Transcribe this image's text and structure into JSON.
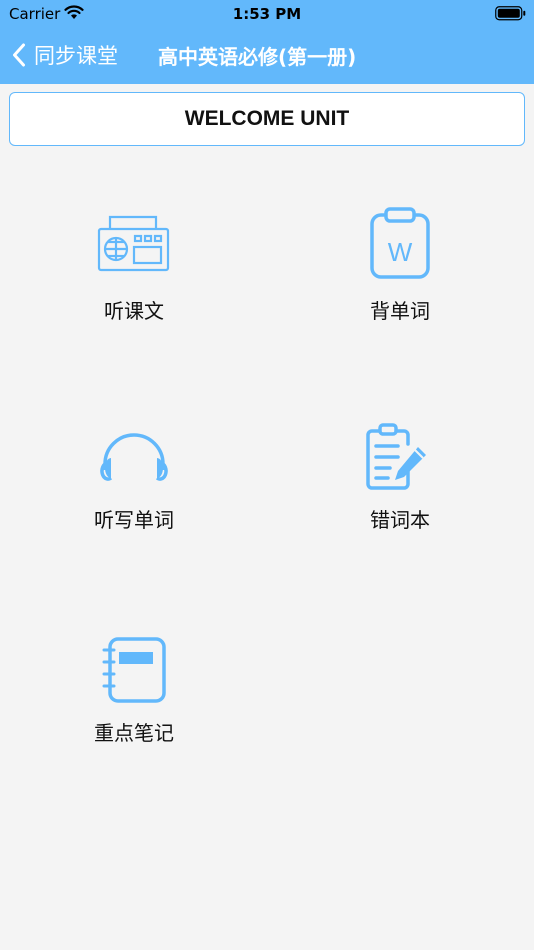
{
  "status_bar": {
    "carrier": "Carrier",
    "time": "1:53 PM"
  },
  "nav": {
    "back_label": "同步课堂",
    "title": "高中英语必修(第一册)"
  },
  "unit_button": {
    "label": "WELCOME UNIT"
  },
  "menu": {
    "listen_text": "听课文",
    "recite_words": "背单词",
    "dictation": "听写单词",
    "wrong_words": "错词本",
    "key_notes": "重点笔记"
  },
  "colors": {
    "accent": "#62b8fb",
    "background": "#f4f4f4"
  }
}
